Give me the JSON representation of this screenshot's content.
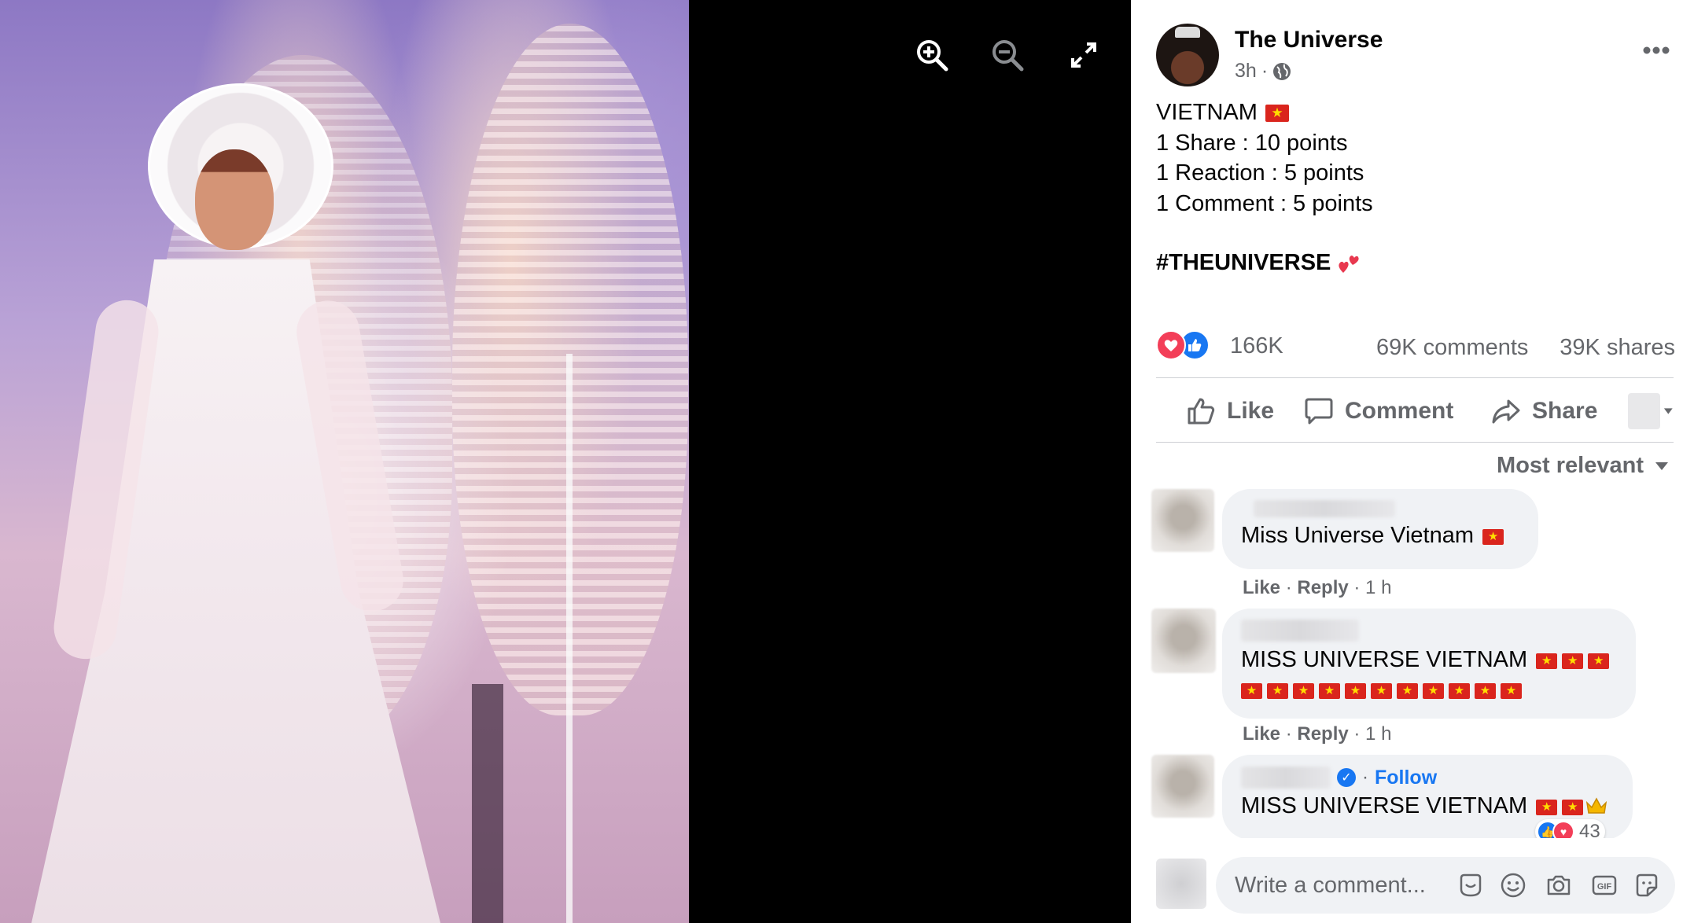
{
  "viewer": {
    "zoom_in_icon": "zoom-in-icon",
    "zoom_out_icon": "zoom-out-icon",
    "fullscreen_icon": "expand-icon"
  },
  "post": {
    "author": "The Universe",
    "time": "3h",
    "privacy_icon": "globe-icon",
    "lines": [
      "VIETNAM",
      "1 Share : 10 points",
      "1 Reaction : 5 points",
      "1 Comment : 5 points"
    ],
    "hashtag": "#THEUNIVERSE"
  },
  "stats": {
    "reactions": "166K",
    "comments": "69K comments",
    "shares": "39K shares"
  },
  "actions": {
    "like": "Like",
    "comment": "Comment",
    "share": "Share"
  },
  "sort": {
    "selected": "Most relevant"
  },
  "comments": [
    {
      "text": "Miss Universe Vietnam",
      "like": "Like",
      "reply": "Reply",
      "time": "1 h"
    },
    {
      "text": "MISS UNIVERSE VIETNAM",
      "like": "Like",
      "reply": "Reply",
      "time": "1 h"
    },
    {
      "follow": "Follow",
      "text": "MISS UNIVERSE VIETNAM",
      "reaction_count": "43"
    }
  ],
  "composer": {
    "placeholder": "Write a comment..."
  },
  "colors": {
    "accent": "#1877f2",
    "love": "#f33e58",
    "flag_red": "#da251d",
    "flag_star": "#ffde00",
    "secondary_text": "#65676b"
  }
}
